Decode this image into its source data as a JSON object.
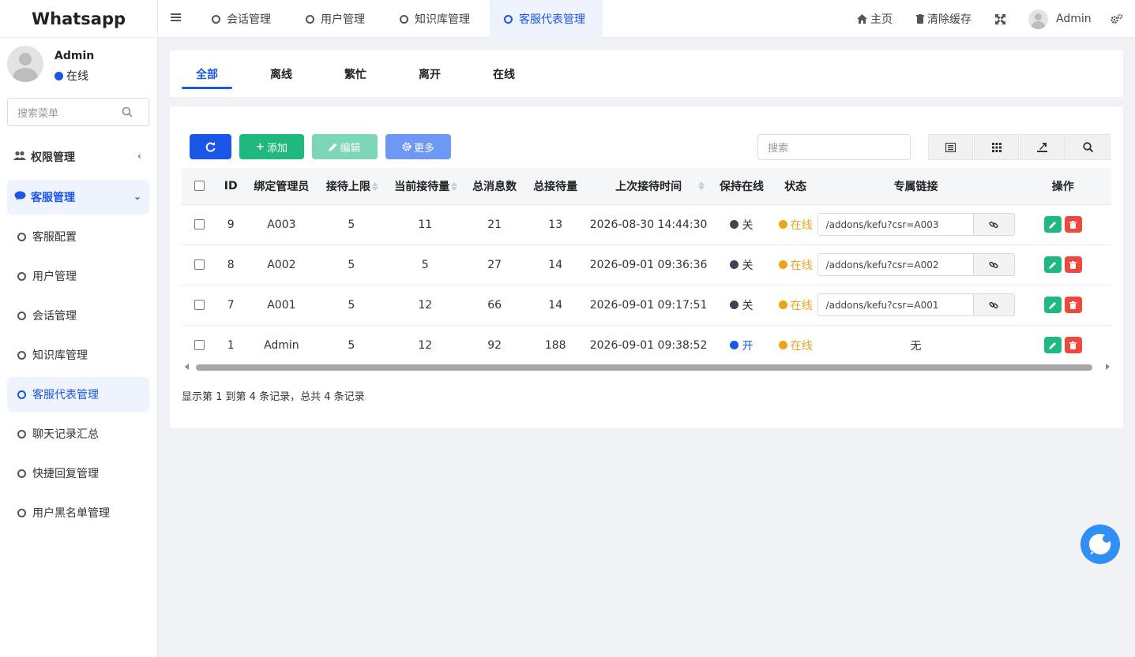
{
  "app": {
    "title": "Whatsapp"
  },
  "user": {
    "name": "Admin",
    "status": "在线"
  },
  "sidebar": {
    "search_placeholder": "搜索菜单",
    "groups": [
      {
        "label": "权限管理",
        "icon": "users-icon"
      },
      {
        "label": "客服管理",
        "icon": "chat-bubble-icon"
      }
    ],
    "items": [
      {
        "label": "客服配置"
      },
      {
        "label": "用户管理"
      },
      {
        "label": "会话管理"
      },
      {
        "label": "知识库管理"
      },
      {
        "label": "客服代表管理"
      },
      {
        "label": "聊天记录汇总"
      },
      {
        "label": "快捷回复管理"
      },
      {
        "label": "用户黑名单管理"
      }
    ]
  },
  "topbar": {
    "tabs": [
      {
        "label": "会话管理"
      },
      {
        "label": "用户管理"
      },
      {
        "label": "知识库管理"
      },
      {
        "label": "客服代表管理"
      }
    ],
    "home": "主页",
    "clear_cache": "清除缓存",
    "user": "Admin"
  },
  "status_tabs": [
    "全部",
    "离线",
    "繁忙",
    "离开",
    "在线"
  ],
  "toolbar": {
    "add": "添加",
    "edit": "编辑",
    "more": "更多",
    "search_placeholder": "搜索"
  },
  "table": {
    "headers": [
      "ID",
      "绑定管理员",
      "接待上限",
      "当前接待量",
      "总消息数",
      "总接待量",
      "上次接待时间",
      "保持在线",
      "状态",
      "专属链接",
      "操作"
    ],
    "rows": [
      {
        "id": "9",
        "admin": "A003",
        "limit": "5",
        "current": "11",
        "messages": "21",
        "total": "13",
        "last_time": "2026-08-30 14:44:30",
        "keep": "关",
        "status": "在线",
        "link": "/addons/kefu?csr=A003"
      },
      {
        "id": "8",
        "admin": "A002",
        "limit": "5",
        "current": "5",
        "messages": "27",
        "total": "14",
        "last_time": "2026-09-01 09:36:36",
        "keep": "关",
        "status": "在线",
        "link": "/addons/kefu?csr=A002"
      },
      {
        "id": "7",
        "admin": "A001",
        "limit": "5",
        "current": "12",
        "messages": "66",
        "total": "14",
        "last_time": "2026-09-01 09:17:51",
        "keep": "关",
        "status": "在线",
        "link": "/addons/kefu?csr=A001"
      },
      {
        "id": "1",
        "admin": "Admin",
        "limit": "5",
        "current": "12",
        "messages": "92",
        "total": "188",
        "last_time": "2026-09-01 09:38:52",
        "keep": "开",
        "status": "在线",
        "link": "无"
      }
    ]
  },
  "pager": {
    "summary": "显示第 1 到第 4 条记录，总共 4 条记录"
  },
  "colors": {
    "primary": "#1a56e8",
    "success": "#1fb97f",
    "danger": "#f0483f",
    "warning": "#f0a31a"
  }
}
